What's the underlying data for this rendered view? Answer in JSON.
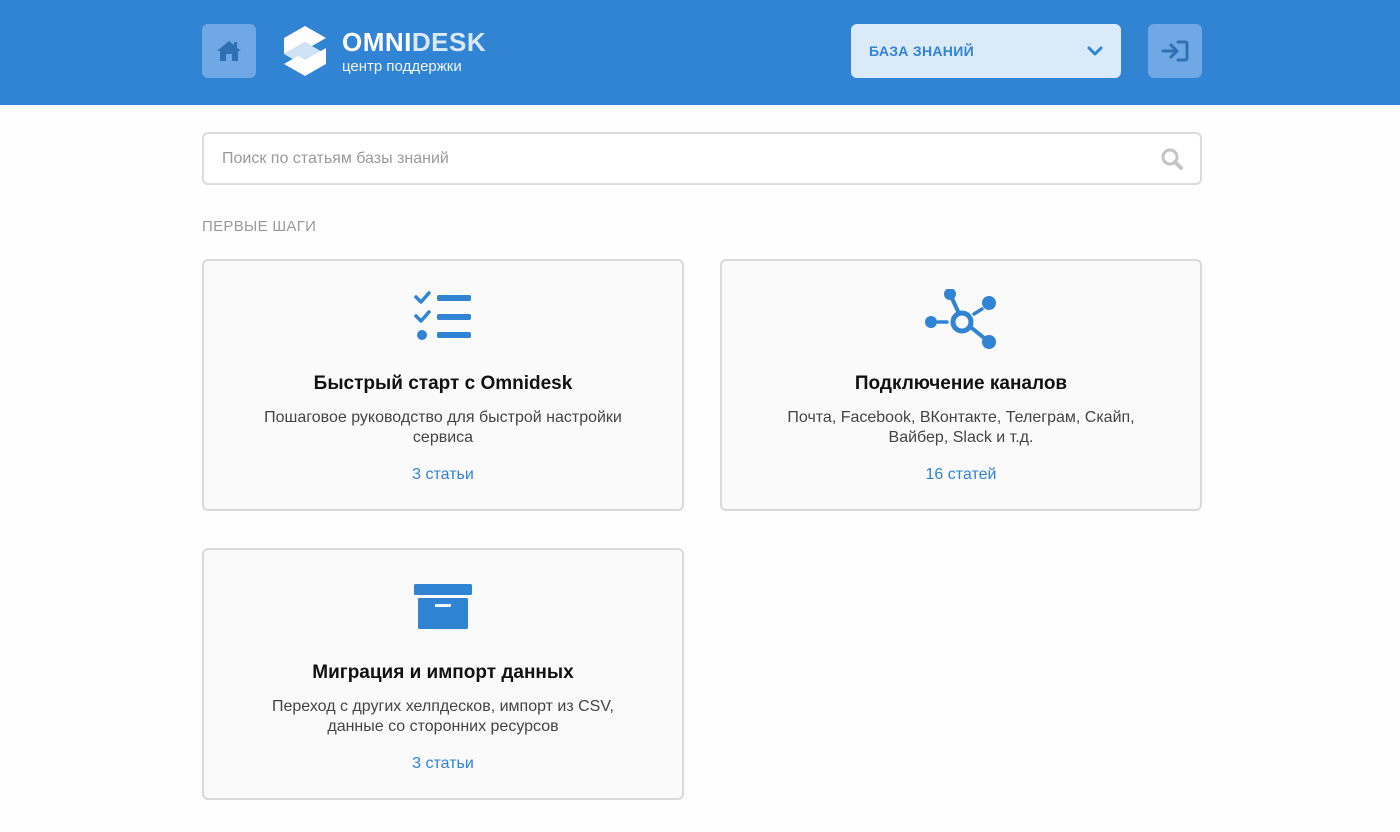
{
  "header": {
    "logo_name_a": "OMNI",
    "logo_name_b": "DESK",
    "logo_subtitle": "центр поддержки",
    "kb_select_label": "БАЗА ЗНАНИЙ"
  },
  "search": {
    "placeholder": "Поиск по статьям базы знаний"
  },
  "section": {
    "title": "ПЕРВЫЕ ШАГИ"
  },
  "cards": [
    {
      "icon": "checklist-icon",
      "title": "Быстрый старт с Omnidesk",
      "desc": "Пошаговое руководство для быстрой настройки сервиса",
      "count": "3 статьи"
    },
    {
      "icon": "network-icon",
      "title": "Подключение каналов",
      "desc": "Почта, Facebook, ВКонтакте, Телеграм, Скайп, Вайбер, Slack и т.д.",
      "count": "16 статей"
    },
    {
      "icon": "archive-box-icon",
      "title": "Миграция и импорт данных",
      "desc": "Переход с других хелпдесков, импорт из CSV, данные со сторонних ресурсов",
      "count": "3 статьи"
    }
  ],
  "colors": {
    "brand": "#3183d3",
    "header_button": "#6fa8e4",
    "select_bg": "#dbeaf8",
    "card_bg": "#fafafb",
    "card_border": "#d9d9d9"
  }
}
